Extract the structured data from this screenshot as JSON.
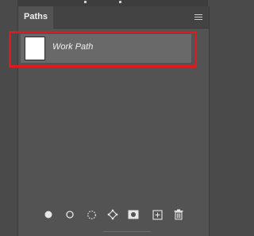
{
  "panel": {
    "tab_label": "Paths",
    "menu_icon": "panel-menu-icon"
  },
  "paths": [
    {
      "name": "Work Path",
      "selected": true
    }
  ],
  "footer_icons": [
    "fill-path-icon",
    "stroke-path-icon",
    "load-selection-icon",
    "make-work-path-icon",
    "add-mask-icon",
    "new-path-icon",
    "delete-path-icon"
  ],
  "colors": {
    "panel_bg": "#535353",
    "row_selected": "#696969",
    "annotation_red": "#e0191c"
  }
}
